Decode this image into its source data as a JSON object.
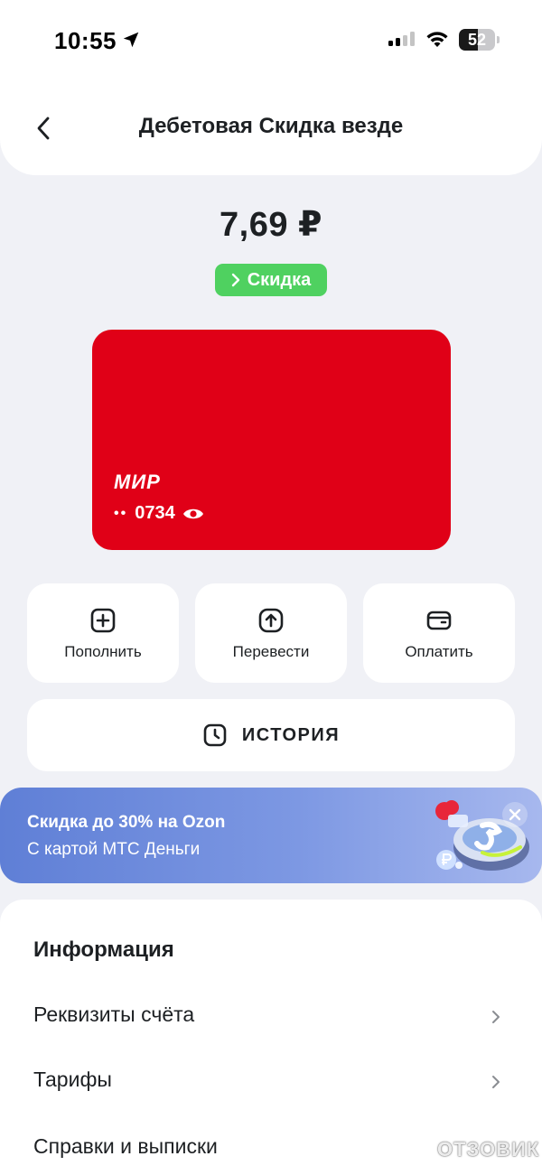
{
  "status_bar": {
    "time": "10:55",
    "battery": "52",
    "battery_level": 0.52,
    "icons": [
      "location-arrow-icon",
      "cellular-signal-icon",
      "wifi-icon",
      "battery-icon"
    ]
  },
  "header": {
    "title": "Дебетовая Скидка везде",
    "back_icon": "chevron-left-icon"
  },
  "account": {
    "balance": "7,69 ₽",
    "badge_label": "Скидка",
    "badge_color": "#4fd160"
  },
  "card": {
    "color": "#e00017",
    "brand": "МИР",
    "masked_prefix": "••",
    "last_digits": "0734",
    "visibility_icon": "eye-icon"
  },
  "actions": [
    {
      "label": "Пополнить",
      "icon": "plus-square-icon"
    },
    {
      "label": "Перевести",
      "icon": "arrow-up-square-icon"
    },
    {
      "label": "Оплатить",
      "icon": "wallet-icon"
    }
  ],
  "history": {
    "label": "ИСТОРИЯ",
    "icon": "clock-icon"
  },
  "promo": {
    "title": "Скидка до 30% на Ozon",
    "subtitle": "С картой МТС Деньги",
    "close_icon": "close-icon"
  },
  "info": {
    "title": "Информация",
    "items": [
      {
        "label": "Реквизиты счёта"
      },
      {
        "label": "Тарифы"
      },
      {
        "label": "Справки и выписки"
      }
    ]
  },
  "watermark": {
    "text": "ОТЗОВИК"
  }
}
